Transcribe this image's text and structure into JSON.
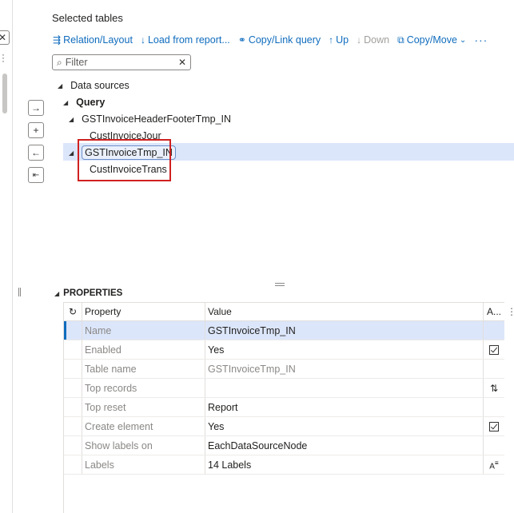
{
  "section_title": "Selected tables",
  "toolbar": {
    "relation_layout": "Relation/Layout",
    "load_from_report": "Load from report...",
    "copy_link_query": "Copy/Link query",
    "up": "Up",
    "down": "Down",
    "copy_move": "Copy/Move",
    "more": "···"
  },
  "filter": {
    "placeholder": "Filter"
  },
  "tree": {
    "root": "Data sources",
    "query": "Query",
    "header_footer": "GSTInvoiceHeaderFooterTmp_IN",
    "cust_invoice_jour": "CustInvoiceJour",
    "invoice_tmp": "GSTInvoiceTmp_IN",
    "cust_invoice_trans": "CustInvoiceTrans"
  },
  "properties": {
    "title": "PROPERTIES",
    "columns": {
      "property": "Property",
      "value": "Value",
      "a": "A..."
    },
    "rows": [
      {
        "property": "Name",
        "value": "GSTInvoiceTmp_IN"
      },
      {
        "property": "Enabled",
        "value": "Yes"
      },
      {
        "property": "Table name",
        "value": "GSTInvoiceTmp_IN"
      },
      {
        "property": "Top records",
        "value": ""
      },
      {
        "property": "Top reset",
        "value": "Report"
      },
      {
        "property": "Create element",
        "value": "Yes"
      },
      {
        "property": "Show labels on",
        "value": "EachDataSourceNode"
      },
      {
        "property": "Labels",
        "value": "14 Labels"
      }
    ]
  },
  "icons": {
    "arrow_right": "→",
    "plus": "+",
    "arrow_left": "←",
    "collapse_left": "⇤"
  },
  "colors": {
    "accent": "#0f6cbd",
    "selection": "#dce6fa",
    "highlight_box": "#d02020"
  }
}
